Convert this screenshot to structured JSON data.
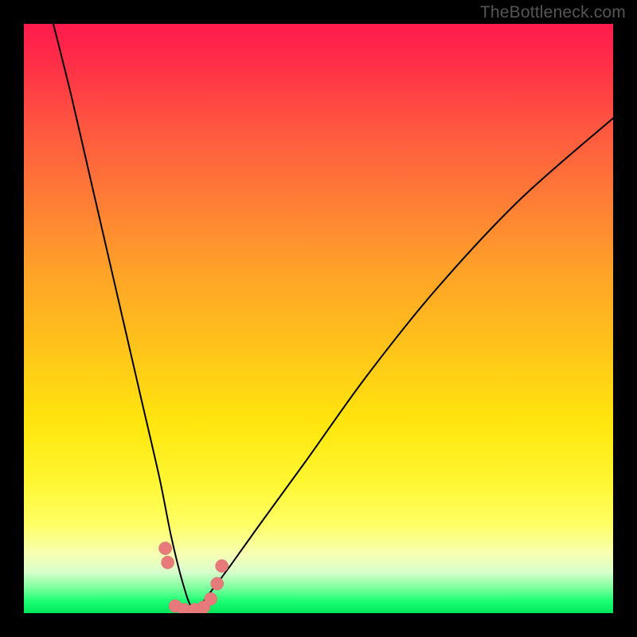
{
  "watermark": "TheBottleneck.com",
  "colors": {
    "frame": "#000000",
    "curve_stroke": "#000000",
    "marker_fill": "#e77b7b",
    "marker_stroke": "#d86a6a"
  },
  "chart_data": {
    "type": "line",
    "title": "",
    "xlabel": "",
    "ylabel": "",
    "xlim": [
      0,
      100
    ],
    "ylim": [
      0,
      100
    ],
    "grid": false,
    "legend": "none",
    "description": "V-shaped bottleneck curve on vertical red→yellow→green gradient. Curve descends steeply from upper-left, reaches a minimum near x≈28 at y≈0, then rises with a gentler concave arc toward upper-right. A cluster of salmon-colored marker dots sits near the minimum.",
    "series": [
      {
        "name": "bottleneck-curve",
        "x": [
          5,
          8,
          11,
          14,
          17,
          20,
          23,
          25,
          27,
          28.5,
          30,
          32,
          35,
          40,
          48,
          58,
          70,
          84,
          100
        ],
        "y": [
          100,
          88,
          75,
          62,
          49,
          36,
          23,
          13,
          5,
          1,
          1.5,
          4,
          8,
          15,
          26,
          40,
          55,
          70,
          84
        ]
      }
    ],
    "markers": [
      {
        "x": 24.0,
        "y": 11.0,
        "r": 1.1
      },
      {
        "x": 24.4,
        "y": 8.6,
        "r": 1.1
      },
      {
        "x": 25.7,
        "y": 1.2,
        "r": 1.1
      },
      {
        "x": 27.2,
        "y": 0.6,
        "r": 1.1
      },
      {
        "x": 29.0,
        "y": 0.6,
        "r": 1.1
      },
      {
        "x": 30.5,
        "y": 1.0,
        "r": 1.1
      },
      {
        "x": 31.7,
        "y": 2.4,
        "r": 1.1
      },
      {
        "x": 32.8,
        "y": 5.0,
        "r": 1.1
      },
      {
        "x": 33.6,
        "y": 8.0,
        "r": 1.1
      }
    ]
  }
}
